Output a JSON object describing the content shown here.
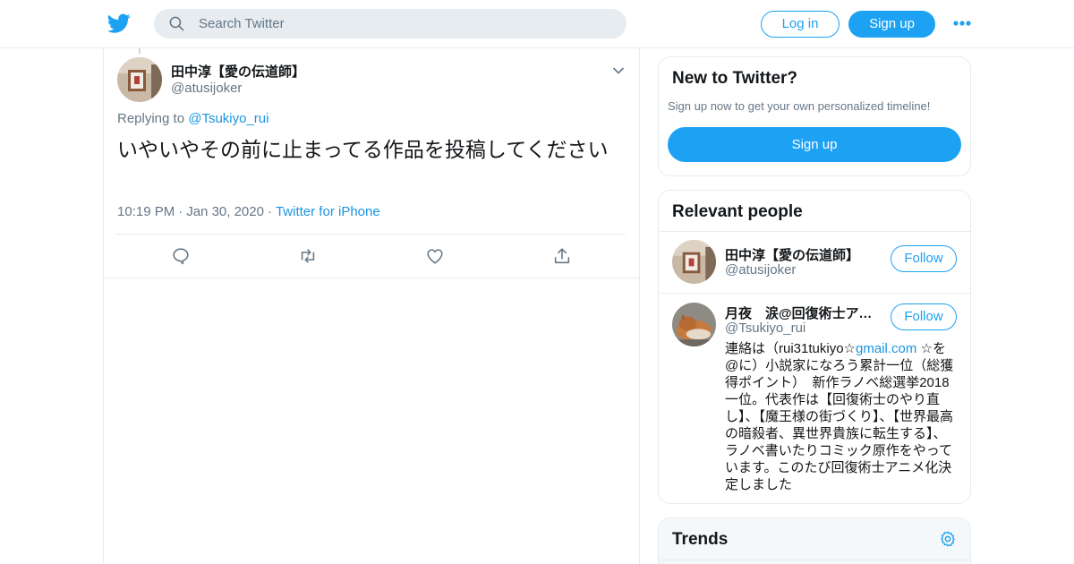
{
  "header": {
    "search_placeholder": "Search Twitter",
    "login_label": "Log in",
    "signup_label": "Sign up",
    "brand_color": "#1da1f2"
  },
  "tweet": {
    "author_name": "田中淳【愛の伝道師】",
    "author_handle": "@atusijoker",
    "replying_prefix": "Replying to",
    "replying_to": "@Tsukiyo_rui",
    "text": "いやいやその前に止まってる作品を投稿してください",
    "time": "10:19 PM",
    "date": "Jan 30, 2020",
    "source": "Twitter for iPhone",
    "dot": "·"
  },
  "sidebar": {
    "new_to_twitter": {
      "title": "New to Twitter?",
      "subtitle": "Sign up now to get your own personalized timeline!",
      "button": "Sign up"
    },
    "relevant_people": {
      "title": "Relevant people",
      "people": [
        {
          "name": "田中淳【愛の伝道師】",
          "handle": "@atusijoker",
          "follow": "Follow"
        },
        {
          "name": "月夜　涙@回復術士アニメ化決定",
          "handle": "@Tsukiyo_rui",
          "follow": "Follow",
          "bio_pre": "連絡は（rui31tukiyo☆",
          "bio_link": "gmail.com",
          "bio_post": " ☆を@に）小説家になろう累計一位（総獲得ポイント）　新作ラノベ総選挙2018一位。代表作は【回復術士のやり直し】、【魔王様の街づくり】、【世界最高の暗殺者、異世界貴族に転生する】、ラノベ書いたりコミック原作をやっています。このたび回復術士アニメ化決定しました"
        }
      ]
    },
    "trends": {
      "title": "Trends"
    }
  }
}
